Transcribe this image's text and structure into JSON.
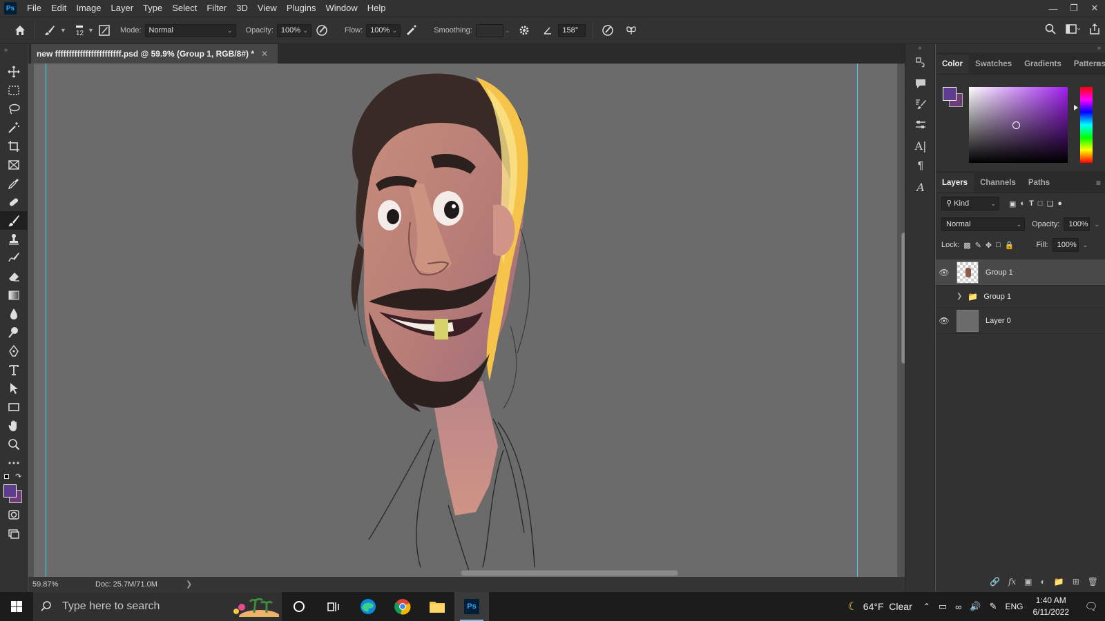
{
  "app": {
    "logo": "Ps",
    "menu": [
      "File",
      "Edit",
      "Image",
      "Layer",
      "Type",
      "Select",
      "Filter",
      "3D",
      "View",
      "Plugins",
      "Window",
      "Help"
    ]
  },
  "options_bar": {
    "brush_size": "12",
    "mode_label": "Mode:",
    "mode_value": "Normal",
    "opacity_label": "Opacity:",
    "opacity_value": "100%",
    "flow_label": "Flow:",
    "flow_value": "100%",
    "smoothing_label": "Smoothing:",
    "smoothing_value": "",
    "angle_value": "158°"
  },
  "document": {
    "tab_title": "new ffffffffffffffffffffffff.psd @ 59.9% (Group 1, RGB/8#) *",
    "zoom": "59.87%",
    "doc_info": "Doc: 25.7M/71.0M"
  },
  "color_panel": {
    "tabs": [
      "Color",
      "Swatches",
      "Gradients",
      "Patterns"
    ],
    "foreground": "#5c3d8f",
    "background": "#6e3c78"
  },
  "layers_panel": {
    "tabs": [
      "Layers",
      "Channels",
      "Paths"
    ],
    "filter_label": "Kind",
    "blend_mode": "Normal",
    "opacity_label": "Opacity:",
    "opacity_value": "100%",
    "lock_label": "Lock:",
    "fill_label": "Fill:",
    "fill_value": "100%",
    "layers": [
      {
        "name": "Group 1",
        "visible": true,
        "selected": true
      },
      {
        "name": "Group 1",
        "visible": false,
        "selected": false
      },
      {
        "name": "Layer 0",
        "visible": true,
        "selected": false
      }
    ]
  },
  "taskbar": {
    "search_placeholder": "Type here to search",
    "weather": "64°F  Clear",
    "language": "ENG",
    "time": "1:40 AM",
    "date": "6/11/2022"
  }
}
